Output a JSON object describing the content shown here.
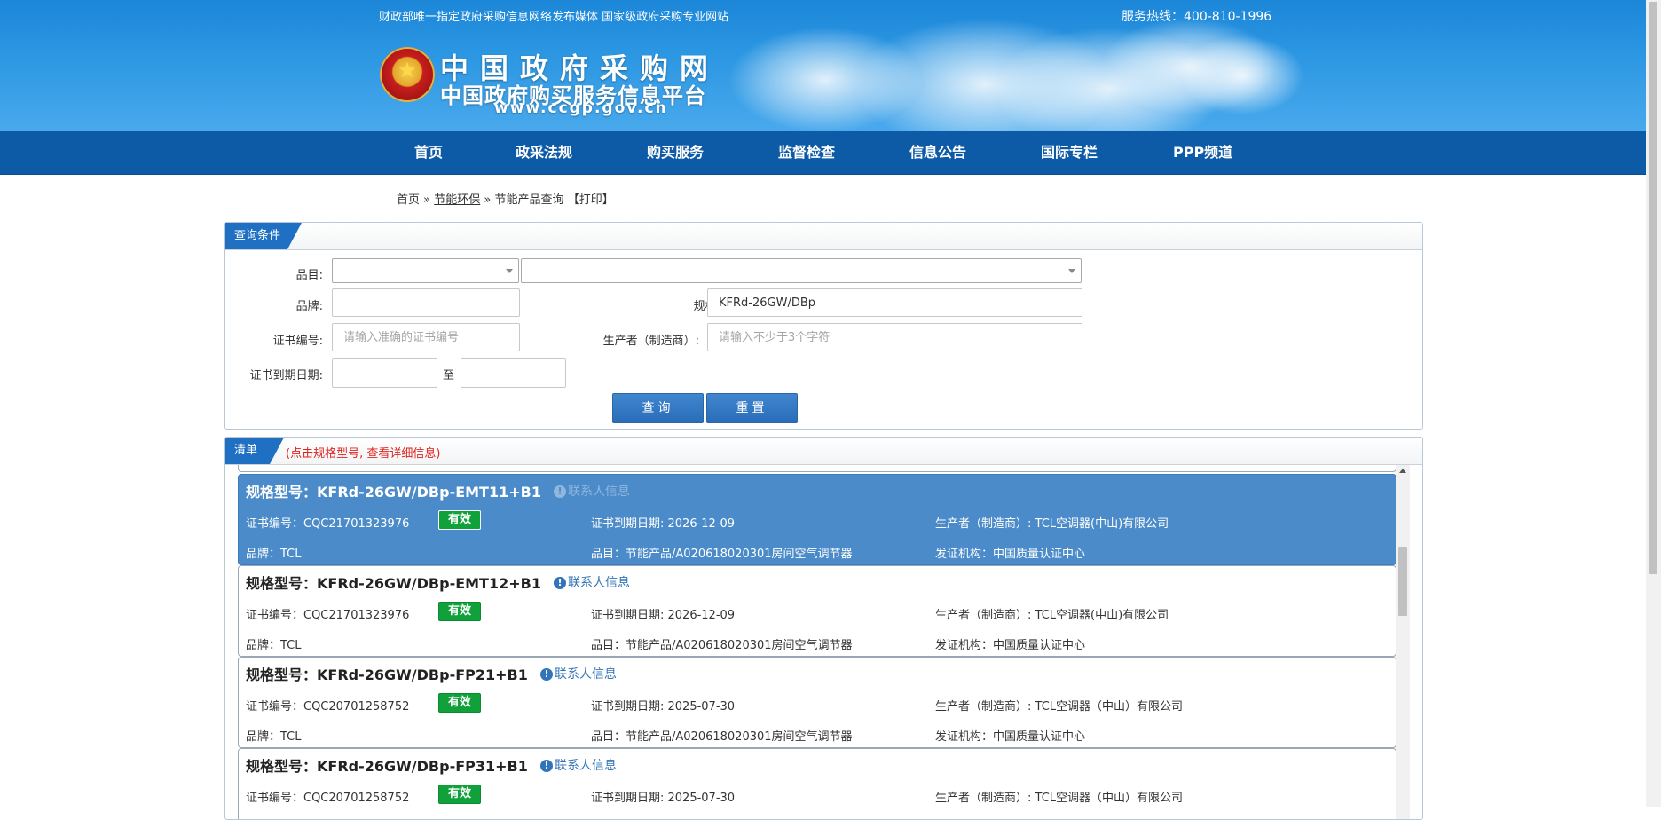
{
  "header": {
    "slogan": "财政部唯一指定政府采购信息网络发布媒体 国家级政府采购专业网站",
    "hotline": "服务热线：400-810-1996",
    "logo_line1": "中国政府采购网",
    "logo_line2": "中国政府购买服务信息平台",
    "logo_url": "www.ccgp.gov.cn"
  },
  "nav": {
    "items": [
      "首页",
      "政采法规",
      "购买服务",
      "监督检查",
      "信息公告",
      "国际专栏",
      "PPP频道"
    ]
  },
  "breadcrumb": {
    "home": "首页",
    "sep1": "»",
    "section": "节能环保",
    "sep2": "»",
    "current": "节能产品查询",
    "print": "【打印】"
  },
  "query": {
    "tab": "查询条件",
    "category_label": "品目:",
    "brand_label": "品牌:",
    "brand_value": "",
    "model_label": "规格型号:",
    "model_value": "KFRd-26GW/DBp",
    "cert_label": "证书编号:",
    "cert_placeholder": "请输入准确的证书编号",
    "maker_label": "生产者（制造商）:",
    "maker_placeholder": "请输入不少于3个字符",
    "expiry_label": "证书到期日期:",
    "expiry_to": "至",
    "search_button": "查询",
    "reset_button": "重置"
  },
  "list": {
    "tab": "清单",
    "note": "(点击规格型号, 查看详细信息)",
    "contact_label": "联系人信息",
    "items": [
      {
        "model": "规格型号：KFRd-26GW/DBp-EMT11+B1",
        "cert": "证书编号：CQC21701323976",
        "status": "有效",
        "expiry": "证书到期日期: 2026-12-09",
        "maker": "生产者（制造商）: TCL空调器(中山)有限公司",
        "brand": "品牌：TCL",
        "category": "品目：节能产品/A020618020301房间空气调节器",
        "issuer": "发证机构：中国质量认证中心"
      },
      {
        "model": "规格型号：KFRd-26GW/DBp-EMT12+B1",
        "cert": "证书编号：CQC21701323976",
        "status": "有效",
        "expiry": "证书到期日期: 2026-12-09",
        "maker": "生产者（制造商）: TCL空调器(中山)有限公司",
        "brand": "品牌：TCL",
        "category": "品目：节能产品/A020618020301房间空气调节器",
        "issuer": "发证机构：中国质量认证中心"
      },
      {
        "model": "规格型号：KFRd-26GW/DBp-FP21+B1",
        "cert": "证书编号：CQC20701258752",
        "status": "有效",
        "expiry": "证书到期日期: 2025-07-30",
        "maker": "生产者（制造商）: TCL空调器（中山）有限公司",
        "brand": "品牌：TCL",
        "category": "品目：节能产品/A020618020301房间空气调节器",
        "issuer": "发证机构：中国质量认证中心"
      },
      {
        "model": "规格型号：KFRd-26GW/DBp-FP31+B1",
        "cert": "证书编号：CQC20701258752",
        "status": "有效",
        "expiry": "证书到期日期: 2025-07-30",
        "maker": "生产者（制造商）: TCL空调器（中山）有限公司",
        "brand": "",
        "category": "",
        "issuer": ""
      }
    ]
  },
  "colors": {
    "banner": "#2b96e2",
    "nav": "#0d5aa6",
    "selected_row": "#4b8bc9",
    "valid_badge": "#11a13a",
    "note": "#e0231e"
  }
}
